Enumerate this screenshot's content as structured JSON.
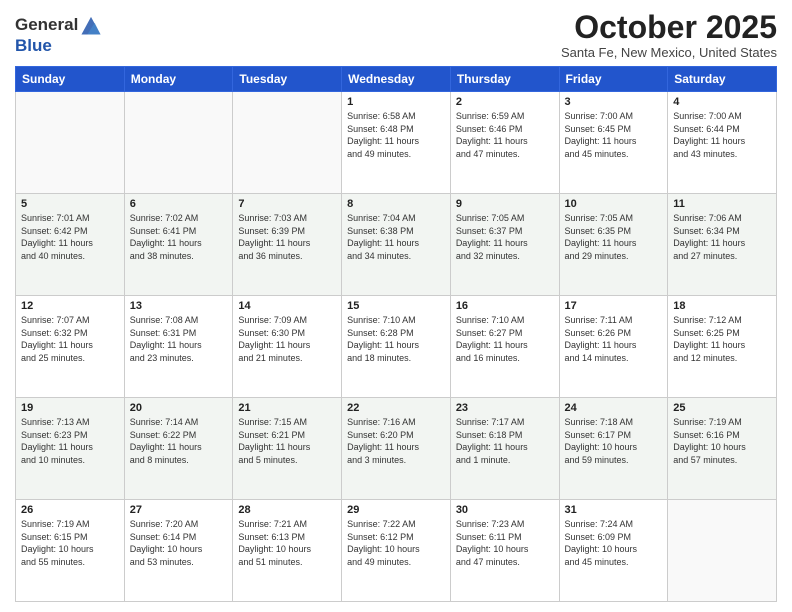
{
  "logo": {
    "general": "General",
    "blue": "Blue"
  },
  "header": {
    "month": "October 2025",
    "location": "Santa Fe, New Mexico, United States"
  },
  "weekdays": [
    "Sunday",
    "Monday",
    "Tuesday",
    "Wednesday",
    "Thursday",
    "Friday",
    "Saturday"
  ],
  "weeks": [
    [
      {
        "day": "",
        "info": ""
      },
      {
        "day": "",
        "info": ""
      },
      {
        "day": "",
        "info": ""
      },
      {
        "day": "1",
        "info": "Sunrise: 6:58 AM\nSunset: 6:48 PM\nDaylight: 11 hours\nand 49 minutes."
      },
      {
        "day": "2",
        "info": "Sunrise: 6:59 AM\nSunset: 6:46 PM\nDaylight: 11 hours\nand 47 minutes."
      },
      {
        "day": "3",
        "info": "Sunrise: 7:00 AM\nSunset: 6:45 PM\nDaylight: 11 hours\nand 45 minutes."
      },
      {
        "day": "4",
        "info": "Sunrise: 7:00 AM\nSunset: 6:44 PM\nDaylight: 11 hours\nand 43 minutes."
      }
    ],
    [
      {
        "day": "5",
        "info": "Sunrise: 7:01 AM\nSunset: 6:42 PM\nDaylight: 11 hours\nand 40 minutes."
      },
      {
        "day": "6",
        "info": "Sunrise: 7:02 AM\nSunset: 6:41 PM\nDaylight: 11 hours\nand 38 minutes."
      },
      {
        "day": "7",
        "info": "Sunrise: 7:03 AM\nSunset: 6:39 PM\nDaylight: 11 hours\nand 36 minutes."
      },
      {
        "day": "8",
        "info": "Sunrise: 7:04 AM\nSunset: 6:38 PM\nDaylight: 11 hours\nand 34 minutes."
      },
      {
        "day": "9",
        "info": "Sunrise: 7:05 AM\nSunset: 6:37 PM\nDaylight: 11 hours\nand 32 minutes."
      },
      {
        "day": "10",
        "info": "Sunrise: 7:05 AM\nSunset: 6:35 PM\nDaylight: 11 hours\nand 29 minutes."
      },
      {
        "day": "11",
        "info": "Sunrise: 7:06 AM\nSunset: 6:34 PM\nDaylight: 11 hours\nand 27 minutes."
      }
    ],
    [
      {
        "day": "12",
        "info": "Sunrise: 7:07 AM\nSunset: 6:32 PM\nDaylight: 11 hours\nand 25 minutes."
      },
      {
        "day": "13",
        "info": "Sunrise: 7:08 AM\nSunset: 6:31 PM\nDaylight: 11 hours\nand 23 minutes."
      },
      {
        "day": "14",
        "info": "Sunrise: 7:09 AM\nSunset: 6:30 PM\nDaylight: 11 hours\nand 21 minutes."
      },
      {
        "day": "15",
        "info": "Sunrise: 7:10 AM\nSunset: 6:28 PM\nDaylight: 11 hours\nand 18 minutes."
      },
      {
        "day": "16",
        "info": "Sunrise: 7:10 AM\nSunset: 6:27 PM\nDaylight: 11 hours\nand 16 minutes."
      },
      {
        "day": "17",
        "info": "Sunrise: 7:11 AM\nSunset: 6:26 PM\nDaylight: 11 hours\nand 14 minutes."
      },
      {
        "day": "18",
        "info": "Sunrise: 7:12 AM\nSunset: 6:25 PM\nDaylight: 11 hours\nand 12 minutes."
      }
    ],
    [
      {
        "day": "19",
        "info": "Sunrise: 7:13 AM\nSunset: 6:23 PM\nDaylight: 11 hours\nand 10 minutes."
      },
      {
        "day": "20",
        "info": "Sunrise: 7:14 AM\nSunset: 6:22 PM\nDaylight: 11 hours\nand 8 minutes."
      },
      {
        "day": "21",
        "info": "Sunrise: 7:15 AM\nSunset: 6:21 PM\nDaylight: 11 hours\nand 5 minutes."
      },
      {
        "day": "22",
        "info": "Sunrise: 7:16 AM\nSunset: 6:20 PM\nDaylight: 11 hours\nand 3 minutes."
      },
      {
        "day": "23",
        "info": "Sunrise: 7:17 AM\nSunset: 6:18 PM\nDaylight: 11 hours\nand 1 minute."
      },
      {
        "day": "24",
        "info": "Sunrise: 7:18 AM\nSunset: 6:17 PM\nDaylight: 10 hours\nand 59 minutes."
      },
      {
        "day": "25",
        "info": "Sunrise: 7:19 AM\nSunset: 6:16 PM\nDaylight: 10 hours\nand 57 minutes."
      }
    ],
    [
      {
        "day": "26",
        "info": "Sunrise: 7:19 AM\nSunset: 6:15 PM\nDaylight: 10 hours\nand 55 minutes."
      },
      {
        "day": "27",
        "info": "Sunrise: 7:20 AM\nSunset: 6:14 PM\nDaylight: 10 hours\nand 53 minutes."
      },
      {
        "day": "28",
        "info": "Sunrise: 7:21 AM\nSunset: 6:13 PM\nDaylight: 10 hours\nand 51 minutes."
      },
      {
        "day": "29",
        "info": "Sunrise: 7:22 AM\nSunset: 6:12 PM\nDaylight: 10 hours\nand 49 minutes."
      },
      {
        "day": "30",
        "info": "Sunrise: 7:23 AM\nSunset: 6:11 PM\nDaylight: 10 hours\nand 47 minutes."
      },
      {
        "day": "31",
        "info": "Sunrise: 7:24 AM\nSunset: 6:09 PM\nDaylight: 10 hours\nand 45 minutes."
      },
      {
        "day": "",
        "info": ""
      }
    ]
  ]
}
